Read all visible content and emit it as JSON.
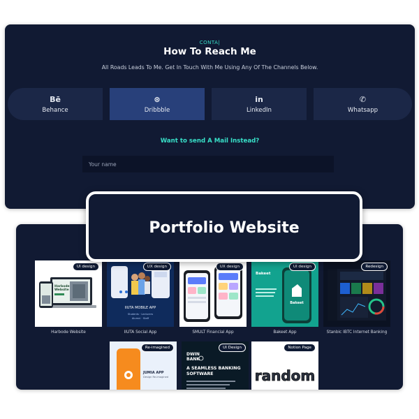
{
  "contact": {
    "kicker": "CONTA|",
    "title": "How To Reach Me",
    "subtitle": "All Roads Leads To Me. Get In Touch With Me Using Any Of The Channels Below.",
    "channels": [
      {
        "icon": "Bē",
        "label": "Behance",
        "active": false
      },
      {
        "icon": "⊛",
        "label": "Dribbble",
        "active": true
      },
      {
        "icon": "in",
        "label": "LinkedIn",
        "active": false
      },
      {
        "icon": "✆",
        "label": "Whatsapp",
        "active": false
      }
    ],
    "mail_link": "Want to send A Mail Instead?",
    "name_placeholder": "Your name"
  },
  "highlight": {
    "label": "Portfolio Website"
  },
  "portfolio": {
    "projects": [
      {
        "name": "Harbode Website",
        "badge": "UI design",
        "thumb_text": "Harbode Website"
      },
      {
        "name": "IIUTA Social App",
        "badge": "UX design",
        "thumb_text": "IIUTA MOBILE APP"
      },
      {
        "name": "SMULT Financial App",
        "badge": "UX design",
        "thumb_text": ""
      },
      {
        "name": "Bakeet App",
        "badge": "UI design",
        "thumb_text": "Bakeet"
      },
      {
        "name": "Stanbic IBTC Internet Banking",
        "badge": "Redesign",
        "thumb_text": ""
      },
      {
        "name": "Jumia App",
        "badge": "Re-imagined",
        "thumb_text": "JUMIA APP"
      },
      {
        "name": "Dwin Bank",
        "badge": "UI Design",
        "thumb_text": "A SEAMLESS BANKING SOFTWARE"
      },
      {
        "name": "Random",
        "badge": "Notion Page",
        "thumb_text": "random"
      }
    ]
  }
}
